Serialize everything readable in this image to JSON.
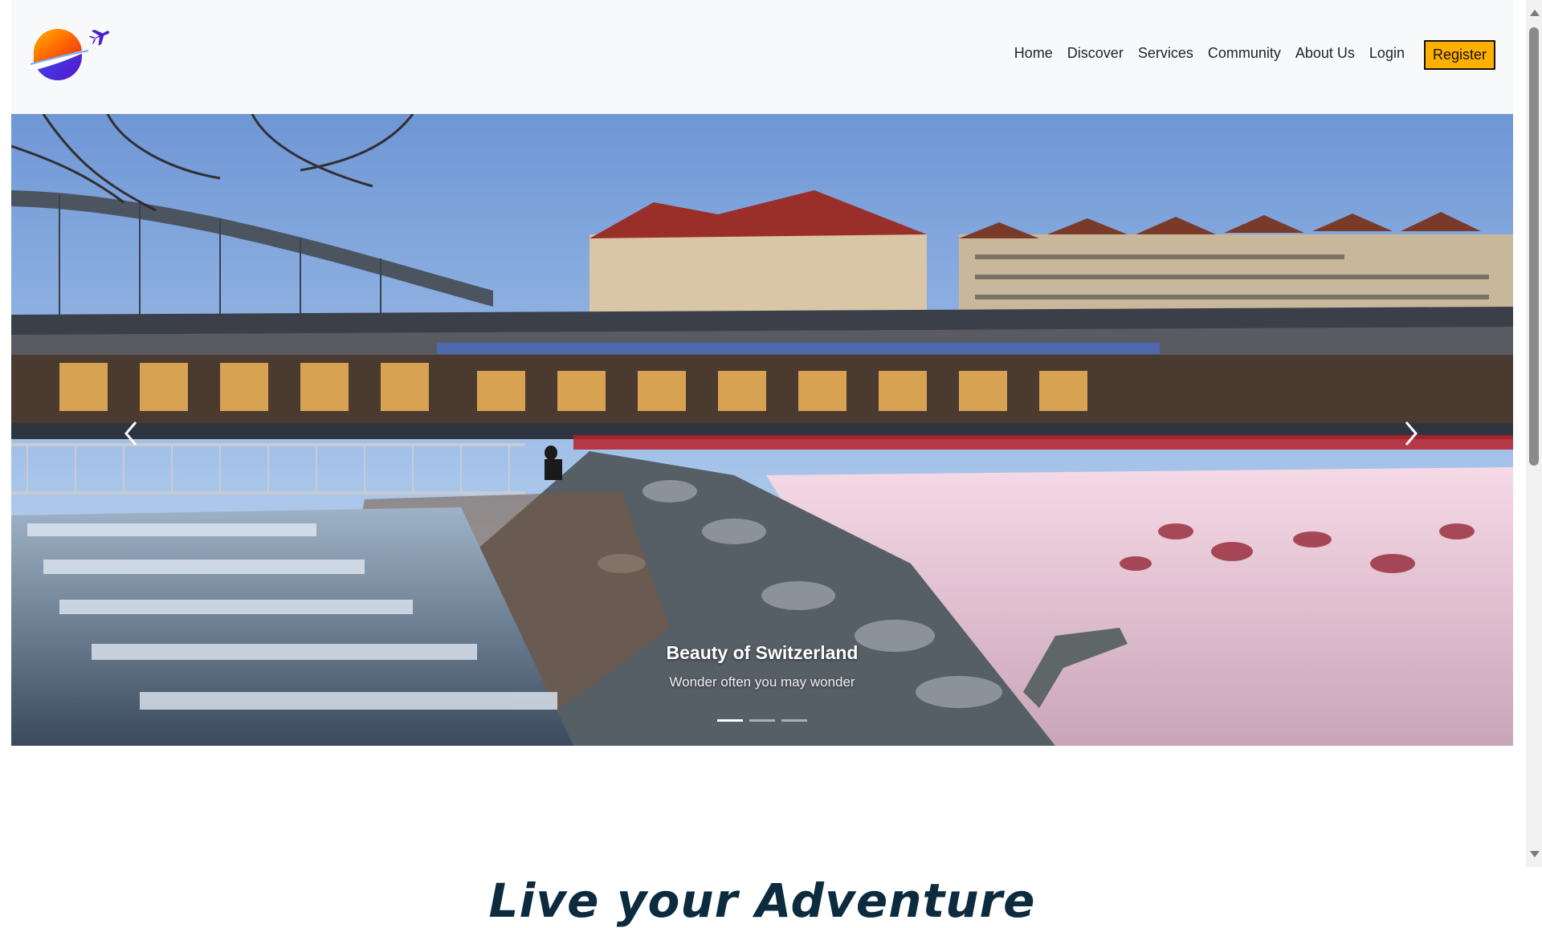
{
  "nav": {
    "logo": "travel-logo",
    "links": [
      "Home",
      "Discover",
      "Services",
      "Community",
      "About Us",
      "Login"
    ],
    "register_label": "Register",
    "register_color": "#ffb000"
  },
  "hero": {
    "caption_title": "Beauty of Switzerland",
    "caption_subtitle": "Wonder often you may wonder",
    "slide_count": 3,
    "active_slide": 1,
    "prev_icon": "chevron-left-icon",
    "next_icon": "chevron-right-icon"
  },
  "section": {
    "title": "Live your Adventure"
  }
}
